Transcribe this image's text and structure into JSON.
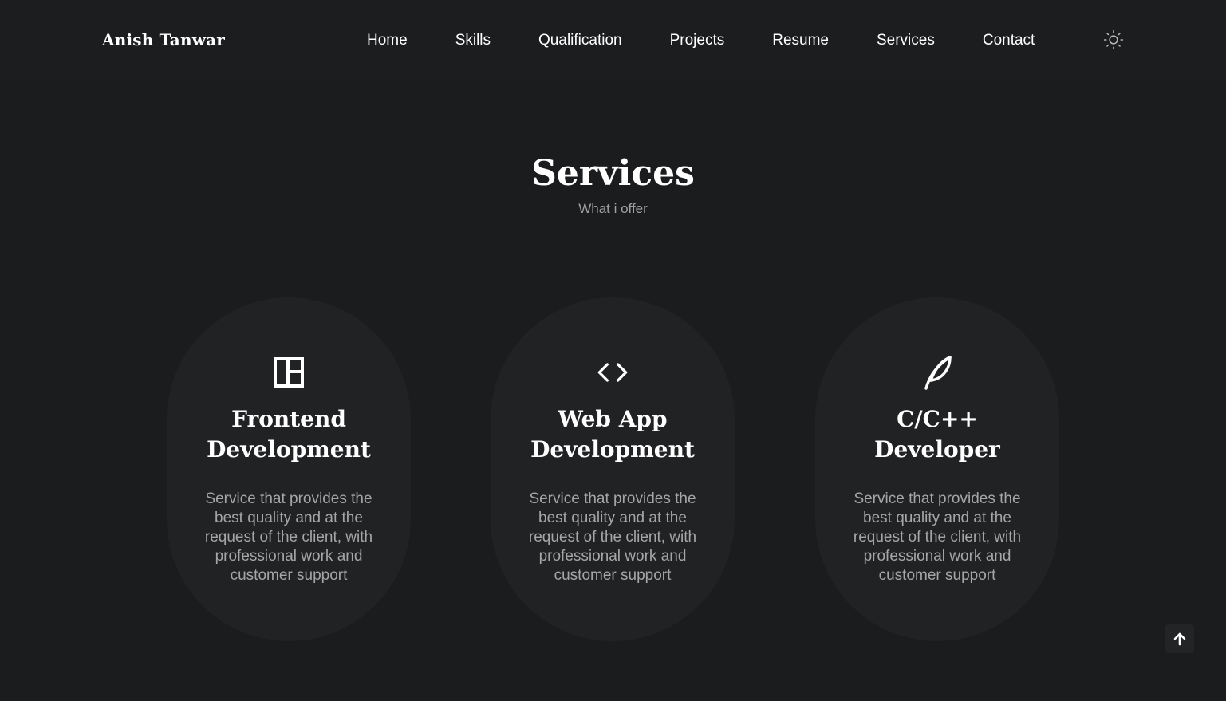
{
  "header": {
    "logo": "Anish Tanwar",
    "nav": [
      "Home",
      "Skills",
      "Qualification",
      "Projects",
      "Resume",
      "Services",
      "Contact"
    ],
    "theme_icon": "sun-icon"
  },
  "section": {
    "title": "Services",
    "subtitle": "What i offer"
  },
  "services": [
    {
      "icon": "layout-icon",
      "title": "Frontend Development",
      "description": "Service that provides the best quality and at the request of the client, with professional work and customer support"
    },
    {
      "icon": "code-icon",
      "title": "Web App Development",
      "description": "Service that provides the best quality and at the request of the client, with professional work and customer support"
    },
    {
      "icon": "feather-icon",
      "title": "C/C++ Developer",
      "description": "Service that provides the best quality and at the request of the client, with professional work and customer support"
    }
  ],
  "scroll_top": {
    "icon": "arrow-up-icon"
  },
  "colors": {
    "background": "#1b1c1e",
    "card": "#212224",
    "text": "#ffffff",
    "muted": "#a6a6a6"
  }
}
